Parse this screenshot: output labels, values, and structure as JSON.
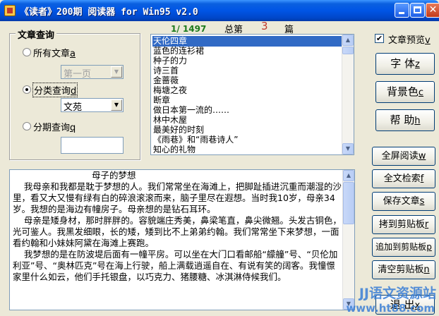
{
  "window": {
    "title": "《读者》200期 阅读器 for Win95 v2.0",
    "minimize": "_",
    "maximize": "□",
    "close": "✕"
  },
  "search_group": {
    "legend": "文章查询",
    "all_articles": {
      "label": "所有文章",
      "hotkey": "a"
    },
    "page_combo_value": "第一页",
    "category": {
      "label": "分类查询",
      "hotkey": "d"
    },
    "category_combo_value": "文苑",
    "issue": {
      "label": "分期查询",
      "hotkey": "q"
    },
    "issue_input_value": ""
  },
  "counter": {
    "position": "1/ 1497",
    "total_prefix": "总第",
    "issue_number": "3",
    "total_suffix": "篇"
  },
  "article_list": {
    "items": [
      "天伦四章",
      "蓝色的连衫裙",
      "种子的力",
      "诗三首",
      "金蔷薇",
      "梅塘之夜",
      "断章",
      "做日本第一流的……",
      "林中木屋",
      "最美好的时刻",
      "《雨巷》和“雨巷诗人”",
      "知心的礼物"
    ],
    "selected_index": 0
  },
  "preview": {
    "label": "文章预览",
    "hotkey": "v",
    "checked": true
  },
  "buttons": {
    "font": {
      "label": "字  体",
      "hotkey": "z"
    },
    "background": {
      "label": "背景色",
      "hotkey": "c"
    },
    "help": {
      "label": "帮  助",
      "hotkey": "h"
    },
    "fullscreen": {
      "label": "全屏阅读",
      "hotkey": "w"
    },
    "fulltext_search": {
      "label": "全文检索",
      "hotkey": "f"
    },
    "save": {
      "label": "保存文章",
      "hotkey": "s"
    },
    "copy_clipboard": {
      "label": "拷到剪贴板",
      "hotkey": "r"
    },
    "append_clipboard": {
      "label": "追加到剪贴板",
      "hotkey": "p"
    },
    "clear_clipboard": {
      "label": "清空剪贴板",
      "hotkey": "n"
    },
    "exit": {
      "label": "退  出",
      "hotkey": "x"
    }
  },
  "article": {
    "title": "母子的梦想",
    "paragraphs": [
      "    我母亲和我都是耽于梦想的人。我们常常坐在海滩上，把脚趾插进沉重而潮湿的沙里，看又大又慢有绿有白的碎浪滚滚而来，脑子里尽在遐想。当时我10岁，母亲34岁。我想的是海边有幢房子。母亲想的是钻石耳环。",
      "    母亲是矮身材，那时胖胖的。容貌端庄秀美，鼻梁笔直，鼻尖微翘。头发古铜色，光可鉴人。我黑发细眼，长的矮，矮到比不上弟弟约翰。我们常常坐下来梦想，一面看约翰和小妹妹阿黛在海滩上赛跑。",
      "    我梦想的是在防波堤后面有一幢平房。可以坐在大门口看邮船“艨艟”号、“贝伦加利亚”号、“奥林匹克”号在海上行驶，船上满载逍遥自在、有说有笑的阔客。我憧憬家里什么如云，他们手托银盘，以巧克力、猪腰糖、冰淇淋侍候我们。"
    ]
  },
  "watermark": {
    "text": "JJ语文资源站",
    "url": "www.ht88.com"
  },
  "colors": {
    "titlebar": "#0055e5",
    "selection": "#316ac5",
    "counter_green": "#1c7a1c",
    "counter_red": "#c0392b"
  }
}
